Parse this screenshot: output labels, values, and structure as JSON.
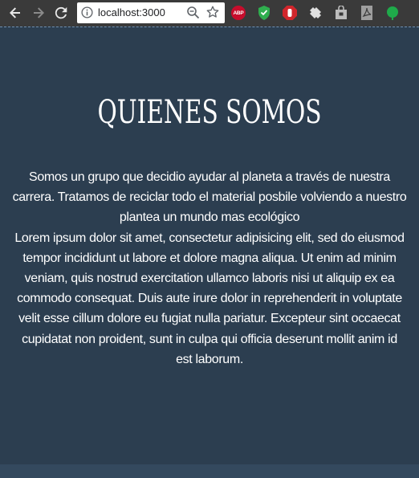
{
  "browser": {
    "url": "localhost:3000",
    "extensions": [
      "abp-icon",
      "shield-icon",
      "stop-icon",
      "puzzle-icon",
      "bag-icon",
      "pdf-icon",
      "evernote-icon"
    ],
    "abp_label": "ABP"
  },
  "section": {
    "title": "QUIENES SOMOS",
    "intro_lines": [
      "Somos un grupo que decidio ayudar al planeta a través de nuestra",
      "carrera. Tratamos de reciclar todo el material posbile volviendo a nuestro",
      "plantea un mundo mas ecológico"
    ],
    "lorem_lines": [
      "Lorem ipsum dolor sit amet, consectetur adipisicing elit, sed do eiusmod",
      "tempor incididunt ut labore et dolore magna aliqua. Ut enim ad minim",
      "veniam, quis nostrud exercitation ullamco laboris nisi ut aliquip ex ea",
      "commodo consequat. Duis aute irure dolor in reprehenderit in voluptate",
      "velit esse cillum dolore eu fugiat nulla pariatur. Excepteur sint occaecat",
      "cupidatat non proident, sunt in culpa qui officia deserunt mollit anim id",
      "est laborum."
    ]
  },
  "colors": {
    "background": "#2c3e50",
    "text": "#ffffff",
    "toolbar": "#3a3a3a"
  }
}
